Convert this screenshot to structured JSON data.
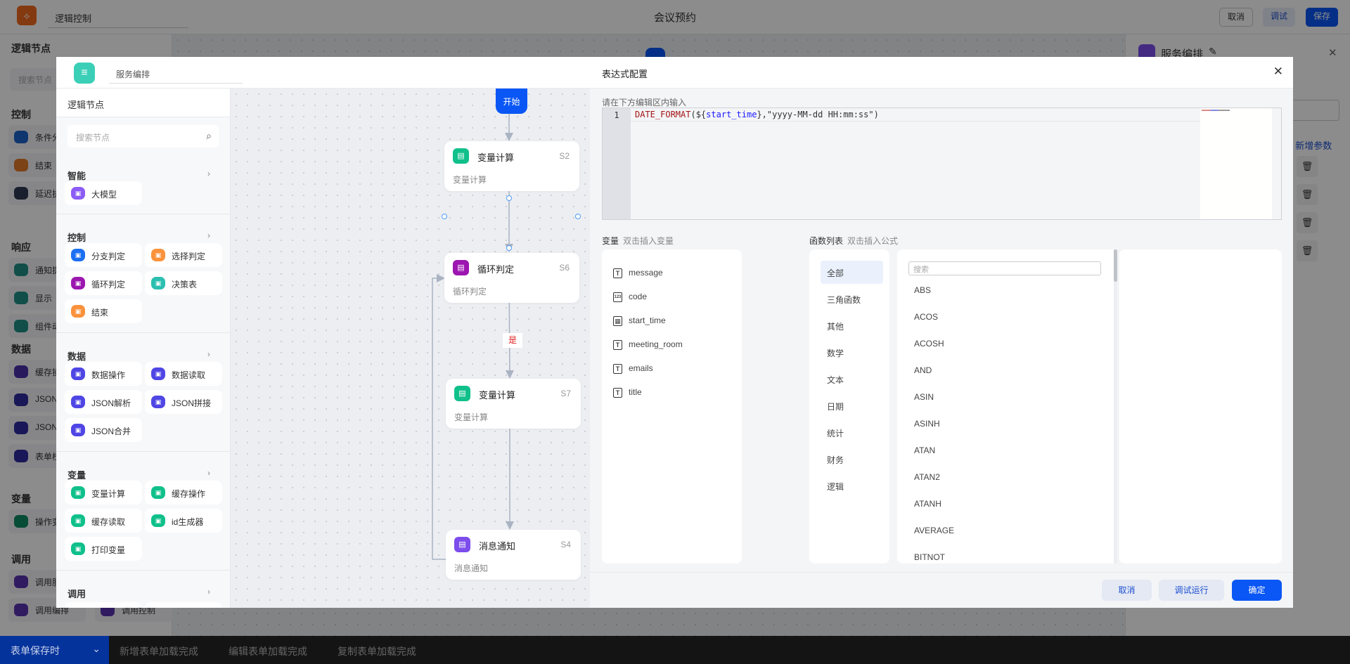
{
  "app": {
    "name": "逻辑控制",
    "title": "会议预约",
    "cancel": "取消",
    "debug": "调试",
    "save": "保存"
  },
  "bg_left": {
    "title": "逻辑节点",
    "search_placeholder": "搜索节点",
    "groups": [
      {
        "title": "控制",
        "items": [
          {
            "label": "条件分",
            "color": "#1d63c9"
          },
          {
            "label": "结束",
            "color": "#e07b28"
          },
          {
            "label": "延迟执",
            "color": "#2f3a52"
          }
        ]
      },
      {
        "title": "响应",
        "items": [
          {
            "label": "通知提",
            "color": "#1f8f86"
          },
          {
            "label": "显示",
            "color": "#1f8f86"
          },
          {
            "label": "组件动",
            "color": "#1f8f86"
          }
        ]
      },
      {
        "title": "数据",
        "items": [
          {
            "label": "缓存操",
            "color": "#4a2fa8"
          },
          {
            "label": "JSON",
            "color": "#2e2b9e"
          },
          {
            "label": "JSON",
            "color": "#2e2b9e"
          },
          {
            "label": "表单校",
            "color": "#2e2b9e"
          }
        ]
      },
      {
        "title": "变量",
        "items": [
          {
            "label": "操作变",
            "color": "#0e8a63"
          }
        ]
      },
      {
        "title": "调用",
        "items": [
          {
            "label": "调用服",
            "color": "#5a32b0"
          },
          {
            "label": "调用编排",
            "color": "#5a32b0"
          }
        ]
      }
    ],
    "extra_item": "调用控制"
  },
  "bg_right": {
    "title": "服务编排",
    "add_param": "+ 新增参数"
  },
  "bottom": {
    "selected": "表单保存时",
    "tabs": [
      "新增表单加载完成",
      "编辑表单加载完成",
      "复制表单加载完成"
    ]
  },
  "modal": {
    "name": "服务编排",
    "sidebar": {
      "title": "逻辑节点",
      "search_placeholder": "搜索节点",
      "groups": [
        {
          "title": "智能",
          "items": [
            {
              "label": "大模型",
              "color": "#8b5cf6",
              "icon": "cloud-icon"
            }
          ]
        },
        {
          "title": "控制",
          "items": [
            {
              "label": "分支判定",
              "color": "#1d6ff2",
              "icon": "branch-icon"
            },
            {
              "label": "选择判定",
              "color": "#fb923c",
              "icon": "shuffle-icon"
            },
            {
              "label": "循环判定",
              "color": "#9c16b0",
              "icon": "loop-icon"
            },
            {
              "label": "决策表",
              "color": "#2bbfb0",
              "icon": "table-icon"
            },
            {
              "label": "结束",
              "color": "#fb923c",
              "icon": "end-icon"
            }
          ]
        },
        {
          "title": "数据",
          "items": [
            {
              "label": "数据操作",
              "color": "#4f46e5",
              "icon": "data-icon"
            },
            {
              "label": "数据读取",
              "color": "#4f46e5",
              "icon": "save-icon"
            },
            {
              "label": "JSON解析",
              "color": "#4f46e5",
              "icon": "json-parse-icon"
            },
            {
              "label": "JSON拼接",
              "color": "#4f46e5",
              "icon": "json-join-icon"
            },
            {
              "label": "JSON合并",
              "color": "#4f46e5",
              "icon": "json-merge-icon"
            }
          ]
        },
        {
          "title": "变量",
          "items": [
            {
              "label": "变量计算",
              "color": "#10c08b",
              "icon": "calc-icon"
            },
            {
              "label": "缓存操作",
              "color": "#10c08b",
              "icon": "save-icon"
            },
            {
              "label": "缓存读取",
              "color": "#10c08b",
              "icon": "cloud-icon"
            },
            {
              "label": "id生成器",
              "color": "#10c08b",
              "icon": "id-icon"
            },
            {
              "label": "打印变量",
              "color": "#10c08b",
              "icon": "variable-icon"
            }
          ]
        },
        {
          "title": "调用",
          "items": []
        }
      ]
    },
    "flow": {
      "start": "开始",
      "nodes": [
        {
          "title": "变量计算",
          "id": "S2",
          "desc": "变量计算",
          "color": "#10c08b"
        },
        {
          "title": "循环判定",
          "id": "S6",
          "desc": "循环判定",
          "color": "#9c16b0"
        },
        {
          "title": "变量计算",
          "id": "S7",
          "desc": "变量计算",
          "color": "#10c08b"
        },
        {
          "title": "消息通知",
          "id": "S4",
          "desc": "消息通知",
          "color": "#7c4dec"
        }
      ],
      "edge_label": "是"
    },
    "expr": {
      "title": "表达式配置",
      "hint": "请在下方编辑区内输入",
      "line_no": "1",
      "code": {
        "fn": "DATE_FORMAT",
        "open": "(${",
        "var": "start_time",
        "mid": "},",
        "str": "\"yyyy-MM-dd HH:mm:ss\"",
        "close": ")"
      },
      "var_label": "变量",
      "var_hint": "双击插入变量",
      "fn_label": "函数列表",
      "fn_hint": "双击插入公式",
      "variables": [
        {
          "name": "message",
          "type": "T"
        },
        {
          "name": "code",
          "type": "123"
        },
        {
          "name": "start_time",
          "type": "date"
        },
        {
          "name": "meeting_room",
          "type": "T"
        },
        {
          "name": "emails",
          "type": "T"
        },
        {
          "name": "title",
          "type": "T"
        }
      ],
      "categories": [
        "全部",
        "三角函数",
        "其他",
        "数学",
        "文本",
        "日期",
        "统计",
        "财务",
        "逻辑"
      ],
      "active_category": "全部",
      "fn_search_placeholder": "搜索",
      "functions": [
        "ABS",
        "ACOS",
        "ACOSH",
        "AND",
        "ASIN",
        "ASINH",
        "ATAN",
        "ATAN2",
        "ATANH",
        "AVERAGE",
        "BITNOT"
      ],
      "cancel": "取消",
      "test_run": "调试运行",
      "confirm": "确定"
    }
  }
}
